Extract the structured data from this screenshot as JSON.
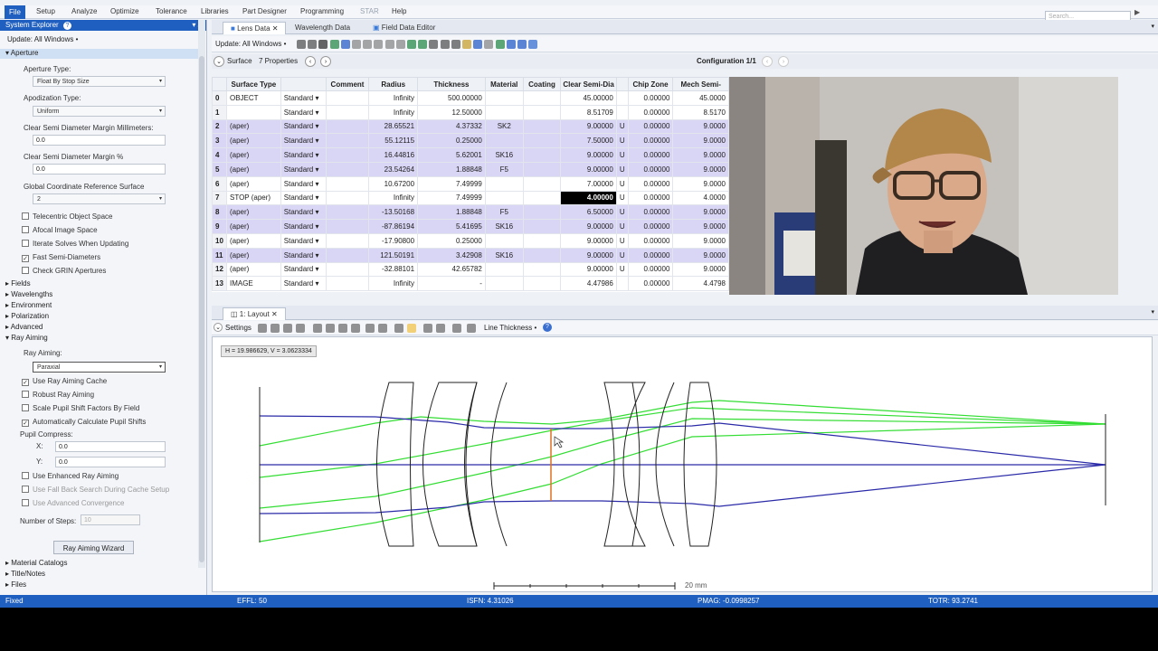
{
  "menu": {
    "file": "File",
    "items": [
      "Setup",
      "Analyze",
      "Optimize",
      "Tolerance",
      "Libraries",
      "Part Designer",
      "Programming",
      "STAR",
      "Help"
    ],
    "search_placeholder": "Search..."
  },
  "system_explorer": {
    "title": "System Explorer",
    "update_label": "Update: All Windows •",
    "aperture_section": "Aperture",
    "aperture_type_label": "Aperture Type:",
    "aperture_type_value": "Float By Stop Size",
    "apodization_label": "Apodization Type:",
    "apodization_value": "Uniform",
    "clear_mm_label": "Clear Semi Diameter Margin Millimeters:",
    "clear_mm_value": "0.0",
    "clear_pct_label": "Clear Semi Diameter Margin %",
    "clear_pct_value": "0.0",
    "gcrs_label": "Global Coordinate Reference Surface",
    "gcrs_value": "2",
    "aperture_checks": [
      {
        "label": "Telecentric Object Space",
        "checked": false
      },
      {
        "label": "Afocal Image Space",
        "checked": false
      },
      {
        "label": "Iterate Solves When Updating",
        "checked": false
      },
      {
        "label": "Fast Semi-Diameters",
        "checked": true
      },
      {
        "label": "Check GRIN Apertures",
        "checked": false
      }
    ],
    "sections": [
      "Fields",
      "Wavelengths",
      "Environment",
      "Polarization",
      "Advanced"
    ],
    "ray_aiming_section": "Ray Aiming",
    "ray_aiming_label": "Ray Aiming:",
    "ray_aiming_value": "Paraxial",
    "ray_checks": [
      {
        "label": "Use Ray Aiming Cache",
        "checked": true
      },
      {
        "label": "Robust Ray Aiming",
        "checked": false
      },
      {
        "label": "Scale Pupil Shift Factors By Field",
        "checked": false
      },
      {
        "label": "Automatically Calculate Pupil Shifts",
        "checked": true
      }
    ],
    "pupil_compress_label": "Pupil Compress:",
    "x_label": "X:",
    "x_value": "0.0",
    "y_label": "Y:",
    "y_value": "0.0",
    "ray_checks2": [
      {
        "label": "Use Enhanced Ray Aiming",
        "checked": false
      },
      {
        "label": "Use Fall Back Search During Cache Setup",
        "checked": false
      },
      {
        "label": "Use Advanced Convergence",
        "checked": false
      }
    ],
    "steps_label": "Number of Steps:",
    "steps_value": "10",
    "wizard_button": "Ray Aiming Wizard",
    "bottom_sections": [
      "Material Catalogs",
      "Title/Notes",
      "Files"
    ]
  },
  "editor_tabs": [
    "Lens Data",
    "Wavelength Data",
    "Field Data Editor"
  ],
  "toolbar": {
    "update_label": "Update: All Windows •"
  },
  "surface_bar": {
    "label": "Surface",
    "properties": "7 Properties",
    "configuration": "Configuration 1/1"
  },
  "lens_table": {
    "headers": [
      "",
      "Surface Type",
      "",
      "Comment",
      "Radius",
      "Thickness",
      "Material",
      "Coating",
      "Clear Semi-Dia",
      "",
      "Chip Zone",
      "Mech Semi-"
    ],
    "rows": [
      [
        "0",
        "OBJECT",
        "Standard ▾",
        "",
        "Infinity",
        "500.00000",
        "",
        "",
        "45.00000",
        "",
        "0.00000",
        "45.0000"
      ],
      [
        "1",
        "",
        "Standard ▾",
        "",
        "Infinity",
        "12.50000",
        "",
        "",
        "8.51709",
        "",
        "0.00000",
        "8.5170"
      ],
      [
        "2",
        "(aper)",
        "Standard ▾",
        "",
        "28.65521",
        "4.37332",
        "SK2",
        "",
        "9.00000",
        "U",
        "0.00000",
        "9.0000"
      ],
      [
        "3",
        "(aper)",
        "Standard ▾",
        "",
        "55.12115",
        "0.25000",
        "",
        "",
        "7.50000",
        "U",
        "0.00000",
        "9.0000"
      ],
      [
        "4",
        "(aper)",
        "Standard ▾",
        "",
        "16.44816",
        "5.62001",
        "SK16",
        "",
        "9.00000",
        "U",
        "0.00000",
        "9.0000"
      ],
      [
        "5",
        "(aper)",
        "Standard ▾",
        "",
        "23.54264",
        "1.88848",
        "F5",
        "",
        "9.00000",
        "U",
        "0.00000",
        "9.0000"
      ],
      [
        "6",
        "(aper)",
        "Standard ▾",
        "",
        "10.67200",
        "7.49999",
        "",
        "",
        "7.00000",
        "U",
        "0.00000",
        "9.0000"
      ],
      [
        "7",
        "STOP (aper)",
        "Standard ▾",
        "",
        "Infinity",
        "7.49999",
        "",
        "",
        "4.00000",
        "U",
        "0.00000",
        "4.0000"
      ],
      [
        "8",
        "(aper)",
        "Standard ▾",
        "",
        "-13.50168",
        "1.88848",
        "F5",
        "",
        "6.50000",
        "U",
        "0.00000",
        "9.0000"
      ],
      [
        "9",
        "(aper)",
        "Standard ▾",
        "",
        "-87.86194",
        "5.41695",
        "SK16",
        "",
        "9.00000",
        "U",
        "0.00000",
        "9.0000"
      ],
      [
        "10",
        "(aper)",
        "Standard ▾",
        "",
        "-17.90800",
        "0.25000",
        "",
        "",
        "9.00000",
        "U",
        "0.00000",
        "9.0000"
      ],
      [
        "11",
        "(aper)",
        "Standard ▾",
        "",
        "121.50191",
        "3.42908",
        "SK16",
        "",
        "9.00000",
        "U",
        "0.00000",
        "9.0000"
      ],
      [
        "12",
        "(aper)",
        "Standard ▾",
        "",
        "-32.88101",
        "42.65782",
        "",
        "",
        "9.00000",
        "U",
        "0.00000",
        "9.0000"
      ],
      [
        "13",
        "IMAGE",
        "Standard ▾",
        "",
        "Infinity",
        "-",
        "",
        "",
        "4.47986",
        "",
        "0.00000",
        "4.4798"
      ]
    ],
    "highlight_rows": [
      2,
      3,
      4,
      5,
      8,
      9,
      11
    ]
  },
  "layout_window": {
    "tab": "1: Layout",
    "settings": "Settings",
    "line_thickness": "Line Thickness •",
    "coords": "H = 19.986629, V = 3.0623334",
    "scale_label": "20 mm"
  },
  "status": {
    "mode": "Fixed",
    "effl": "EFFL: 50",
    "isfn": "ISFN: 4.31026",
    "pmag": "PMAG: -0.0998257",
    "totr": "TOTR: 93.2741"
  },
  "colors": {
    "accent": "#1f5fbf",
    "row_highlight": "#d9d5f5",
    "ray_green": "#33dd33",
    "ray_blue": "#2a2aa8",
    "stop_orange": "#e07020"
  }
}
